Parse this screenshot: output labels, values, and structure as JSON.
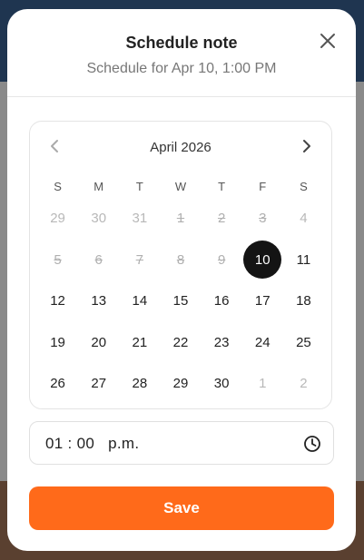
{
  "dialog": {
    "title": "Schedule note",
    "subtitle": "Schedule for Apr 10, 1:00 PM"
  },
  "calendar": {
    "month_label": "April 2026",
    "weekdays": [
      "S",
      "M",
      "T",
      "W",
      "T",
      "F",
      "S"
    ],
    "selected_day": "10",
    "weeks": [
      [
        {
          "d": "29",
          "s": "outside"
        },
        {
          "d": "30",
          "s": "outside"
        },
        {
          "d": "31",
          "s": "outside"
        },
        {
          "d": "1",
          "s": "struck"
        },
        {
          "d": "2",
          "s": "struck"
        },
        {
          "d": "3",
          "s": "struck"
        },
        {
          "d": "4",
          "s": "outside"
        }
      ],
      [
        {
          "d": "5",
          "s": "struck"
        },
        {
          "d": "6",
          "s": "struck"
        },
        {
          "d": "7",
          "s": "struck"
        },
        {
          "d": "8",
          "s": "struck"
        },
        {
          "d": "9",
          "s": "struck"
        },
        {
          "d": "10",
          "s": "selected"
        },
        {
          "d": "11",
          "s": "normal"
        }
      ],
      [
        {
          "d": "12",
          "s": "normal"
        },
        {
          "d": "13",
          "s": "normal"
        },
        {
          "d": "14",
          "s": "normal"
        },
        {
          "d": "15",
          "s": "normal"
        },
        {
          "d": "16",
          "s": "normal"
        },
        {
          "d": "17",
          "s": "normal"
        },
        {
          "d": "18",
          "s": "normal"
        }
      ],
      [
        {
          "d": "19",
          "s": "normal"
        },
        {
          "d": "20",
          "s": "normal"
        },
        {
          "d": "21",
          "s": "normal"
        },
        {
          "d": "22",
          "s": "normal"
        },
        {
          "d": "23",
          "s": "normal"
        },
        {
          "d": "24",
          "s": "normal"
        },
        {
          "d": "25",
          "s": "normal"
        }
      ],
      [
        {
          "d": "26",
          "s": "normal"
        },
        {
          "d": "27",
          "s": "normal"
        },
        {
          "d": "28",
          "s": "normal"
        },
        {
          "d": "29",
          "s": "normal"
        },
        {
          "d": "30",
          "s": "normal"
        },
        {
          "d": "1",
          "s": "outside"
        },
        {
          "d": "2",
          "s": "outside"
        }
      ]
    ]
  },
  "time": {
    "value": "01 : 00   p.m."
  },
  "actions": {
    "save_label": "Save"
  },
  "icons": {
    "close": "close-icon",
    "prev": "chevron-left-icon",
    "next": "chevron-right-icon",
    "clock": "clock-icon"
  },
  "colors": {
    "accent": "#ff6a1a",
    "selected": "#141414"
  }
}
